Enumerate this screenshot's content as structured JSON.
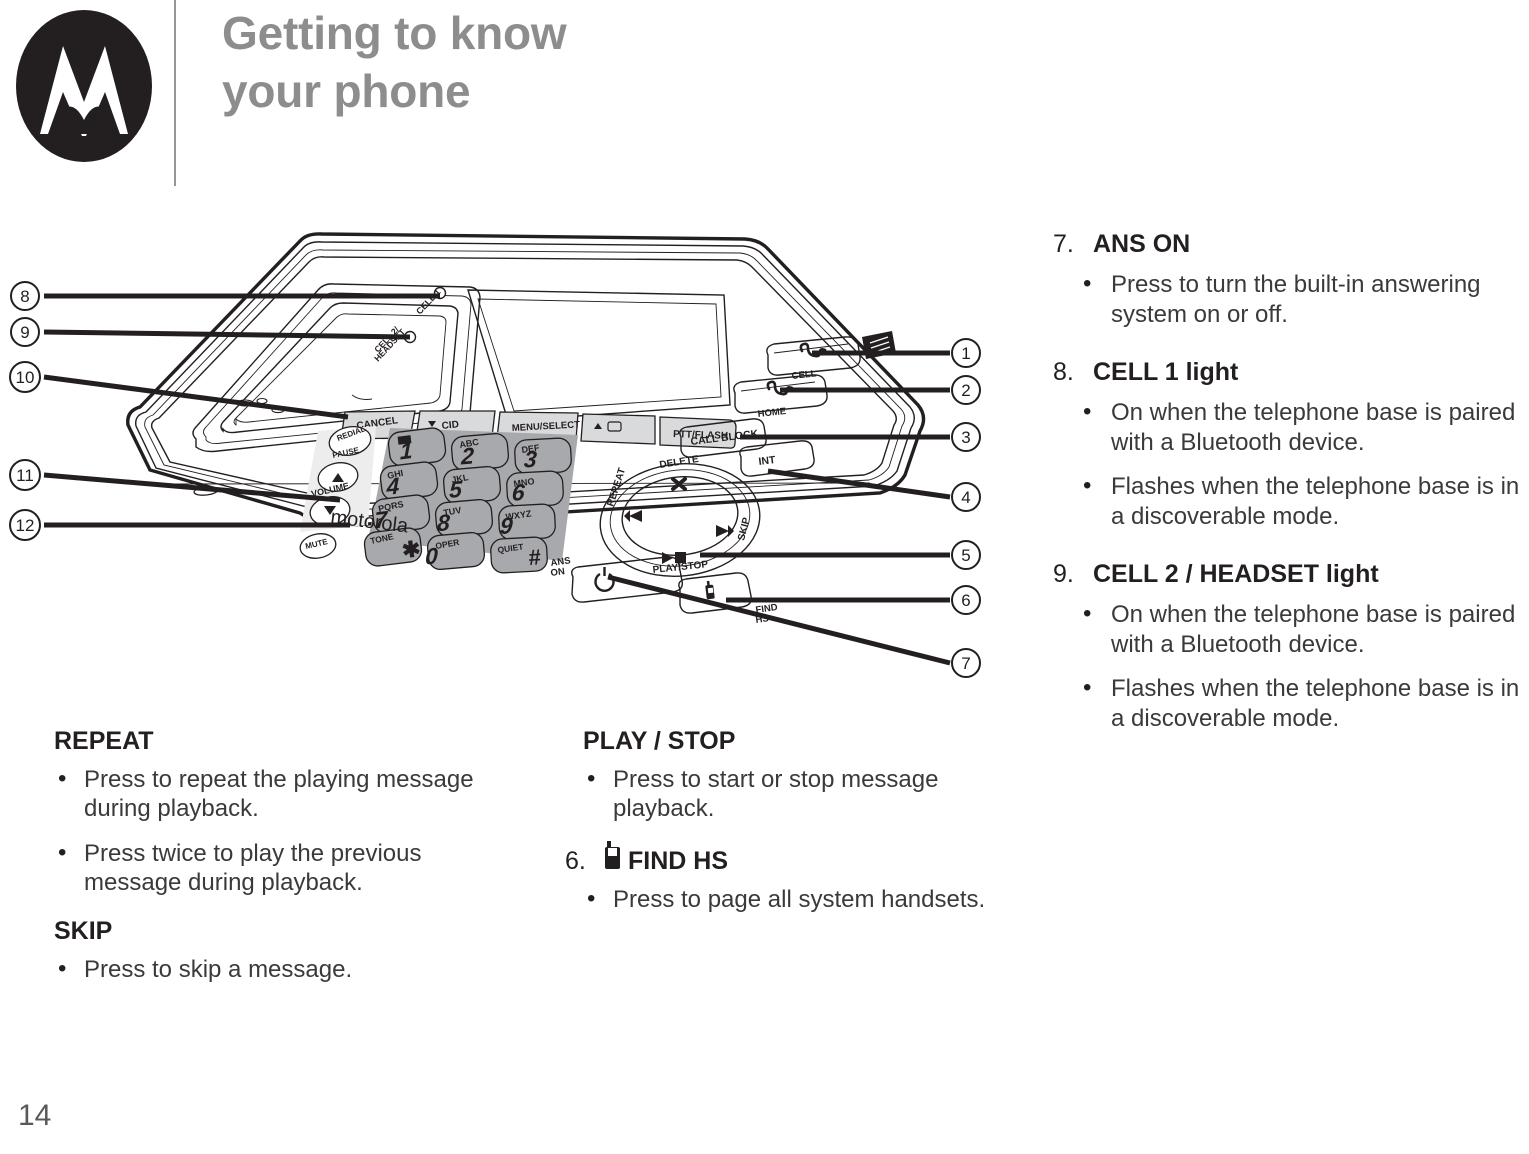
{
  "header": {
    "logo_name": "motorola-logo",
    "title_line1": "Getting to know",
    "title_line2": "your phone"
  },
  "page_number": "14",
  "diagram": {
    "name": "telephone-base-diagram",
    "brand_text": "motorola",
    "callouts_right": [
      "1",
      "2",
      "3",
      "4",
      "5",
      "6",
      "7"
    ],
    "callouts_left": [
      "8",
      "9",
      "10",
      "11",
      "12"
    ],
    "labels": {
      "cell1_light": "CELL 1",
      "cell2_headset_light": "CELL 2/ HEADSET",
      "cancel": "CANCEL",
      "cid": "CID",
      "menu_select": "MENU/SELECT",
      "ptt_flash": "PTT/FLASH",
      "redial_pause": "REDIAL PAUSE",
      "volume": "VOLUME",
      "mute": "MUTE",
      "cell_key": "CELL",
      "home_key": "HOME",
      "call_block": "CALL BLOCK",
      "int": "INT",
      "delete": "DELETE",
      "repeat": "REPEAT",
      "skip": "SKIP",
      "play_stop": "PLAY/STOP",
      "ans_on": "ANS ON",
      "find_hs": "FIND HS"
    },
    "keypad": [
      {
        "digit": "1",
        "letters": ""
      },
      {
        "digit": "2",
        "letters": "ABC"
      },
      {
        "digit": "3",
        "letters": "DEF"
      },
      {
        "digit": "4",
        "letters": "GHI"
      },
      {
        "digit": "5",
        "letters": "JKL"
      },
      {
        "digit": "6",
        "letters": "MNO"
      },
      {
        "digit": "7",
        "letters": "PQRS"
      },
      {
        "digit": "8",
        "letters": "TUV"
      },
      {
        "digit": "9",
        "letters": "WXYZ"
      },
      {
        "digit": "✱",
        "letters": "TONE"
      },
      {
        "digit": "0",
        "letters": "OPER"
      },
      {
        "digit": "#",
        "letters": "QUIET"
      }
    ]
  },
  "col_left": {
    "sections": [
      {
        "number": "",
        "title": "REPEAT",
        "bullets": [
          "Press to repeat the playing message during playback.",
          "Press twice to play the previous message during playback."
        ]
      },
      {
        "number": "",
        "title": "SKIP",
        "bullets": [
          "Press to skip a message."
        ]
      }
    ]
  },
  "col_mid": {
    "sections": [
      {
        "number": "",
        "title": "PLAY / STOP",
        "bullets": [
          "Press to start or stop message playback."
        ]
      },
      {
        "number": "6.",
        "title": "FIND HS",
        "icon": "handset-icon",
        "bullets": [
          "Press to page all system handsets."
        ]
      }
    ]
  },
  "col_right": {
    "sections": [
      {
        "number": "7.",
        "title": "ANS ON",
        "bullets": [
          "Press to turn the built-in answering system on or off."
        ]
      },
      {
        "number": "8.",
        "title": "CELL 1 light",
        "bullets": [
          "On when the telephone base is paired with a Bluetooth device.",
          "Flashes when the telephone base is in a discoverable mode."
        ]
      },
      {
        "number": "9.",
        "title": "CELL 2 / HEADSET light",
        "bullets": [
          "On when the telephone base is paired with a Bluetooth device.",
          "Flashes when the telephone base is in a discoverable mode."
        ]
      }
    ]
  }
}
